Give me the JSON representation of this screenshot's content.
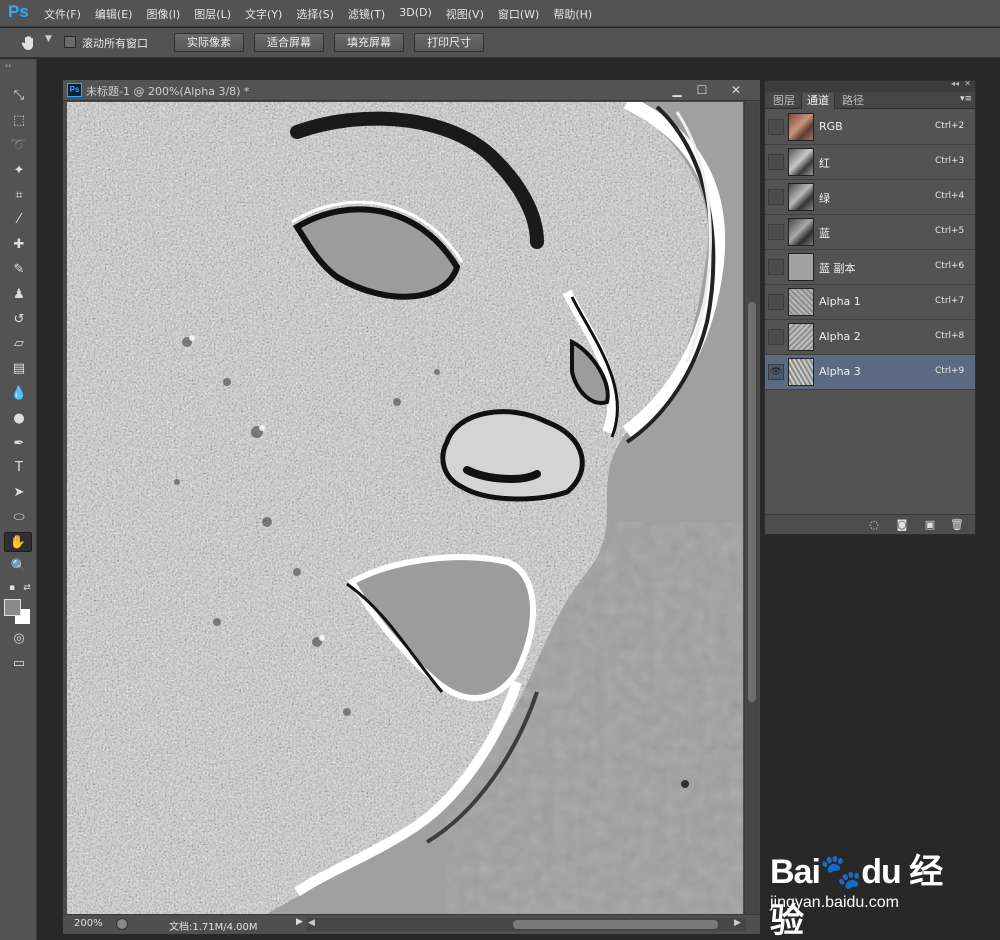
{
  "app": {
    "logo": "Ps"
  },
  "menubar": {
    "items": [
      "文件(F)",
      "编辑(E)",
      "图像(I)",
      "图层(L)",
      "文字(Y)",
      "选择(S)",
      "滤镜(T)",
      "3D(D)",
      "视图(V)",
      "窗口(W)",
      "帮助(H)"
    ]
  },
  "options": {
    "scroll_all_label": "滚动所有窗口",
    "buttons": [
      "实际像素",
      "适合屏幕",
      "填充屏幕",
      "打印尺寸"
    ]
  },
  "document": {
    "title": "未标题-1 @ 200%(Alpha 3/8) *",
    "zoom": "200%",
    "info": "文档:1.71M/4.00M"
  },
  "panel": {
    "tabs": [
      "图层",
      "通道",
      "路径"
    ],
    "active_tab": "通道",
    "channels": [
      {
        "name": "RGB",
        "shortcut": "Ctrl+2",
        "visible": false,
        "thumb": "color"
      },
      {
        "name": "红",
        "shortcut": "Ctrl+3",
        "visible": false,
        "thumb": "gray"
      },
      {
        "name": "绿",
        "shortcut": "Ctrl+4",
        "visible": false,
        "thumb": "gray"
      },
      {
        "name": "蓝",
        "shortcut": "Ctrl+5",
        "visible": false,
        "thumb": "gray"
      },
      {
        "name": "蓝 副本",
        "shortcut": "Ctrl+6",
        "visible": false,
        "thumb": "flat"
      },
      {
        "name": "Alpha 1",
        "shortcut": "Ctrl+7",
        "visible": false,
        "thumb": "texture"
      },
      {
        "name": "Alpha 2",
        "shortcut": "Ctrl+8",
        "visible": false,
        "thumb": "texture"
      },
      {
        "name": "Alpha 3",
        "shortcut": "Ctrl+9",
        "visible": true,
        "thumb": "texture",
        "selected": true
      }
    ]
  },
  "watermark": {
    "logo": "Bai du 经验",
    "url": "jingyan.baidu.com"
  },
  "colors": {
    "accent": "#31a8ff",
    "selected_row": "#5b6a82",
    "ui_gray": "#535353"
  }
}
